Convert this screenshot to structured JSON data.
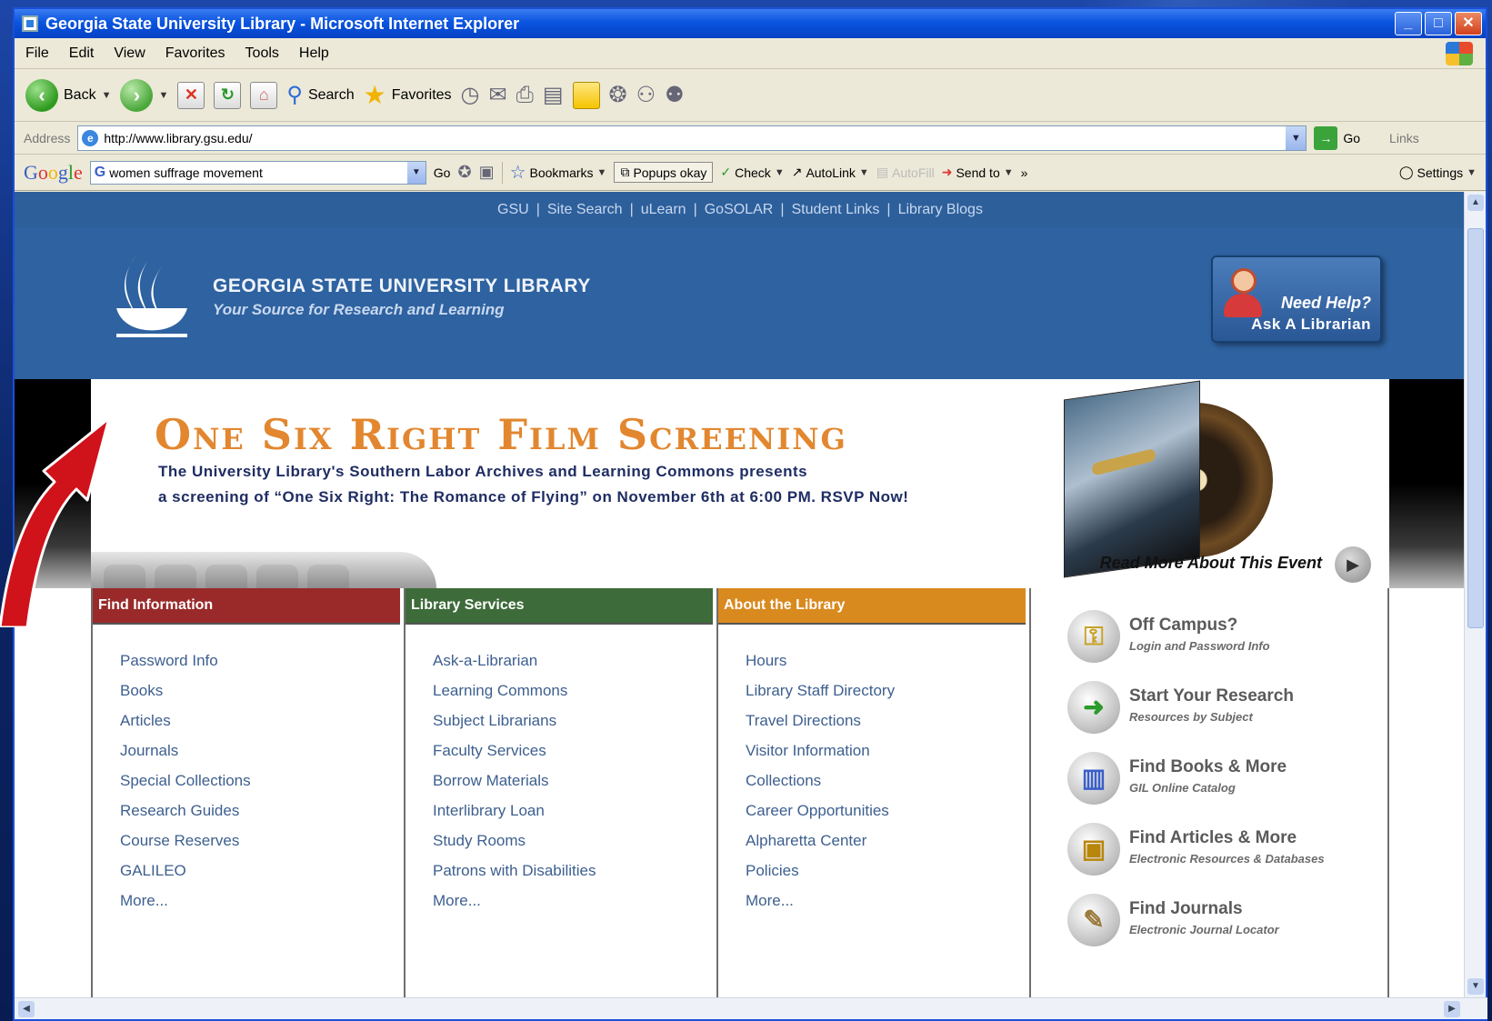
{
  "window": {
    "title": "Georgia State University Library - Microsoft Internet Explorer",
    "buttons": {
      "minimize": "_",
      "maximize": "□",
      "close": "✕"
    }
  },
  "menu": [
    "File",
    "Edit",
    "View",
    "Favorites",
    "Tools",
    "Help"
  ],
  "toolbar": {
    "back": "Back",
    "search": "Search",
    "favorites": "Favorites"
  },
  "address": {
    "label": "Address",
    "url": "http://www.library.gsu.edu/",
    "go": "Go",
    "links": "Links"
  },
  "google_bar": {
    "logo": "Google",
    "query": "women suffrage movement",
    "go": "Go",
    "bookmarks": "Bookmarks",
    "popups": "Popups okay",
    "check": "Check",
    "autolink": "AutoLink",
    "autofill": "AutoFill",
    "send_to": "Send to",
    "more": "»",
    "settings": "Settings"
  },
  "site": {
    "top_links": [
      "GSU",
      "Site Search",
      "uLearn",
      "GoSOLAR",
      "Student Links",
      "Library Blogs"
    ],
    "title": "GEORGIA STATE UNIVERSITY LIBRARY",
    "tagline": "Your Source for Research and Learning",
    "help": {
      "line1": "Need Help?",
      "line2": "Ask A Librarian"
    }
  },
  "hero": {
    "title": "One Six Right Film Screening",
    "line1": "The University Library's Southern Labor Archives and Learning Commons presents",
    "line2": "a screening of “One Six Right: The Romance of Flying” on November 6th at 6:00 PM. RSVP Now!",
    "read_more": "Read More About This Event"
  },
  "columns": [
    {
      "heading": "Find Information",
      "links": [
        "Password Info",
        "Books",
        "Articles",
        "Journals",
        "Special Collections",
        "Research Guides",
        "Course Reserves",
        "GALILEO",
        "More..."
      ]
    },
    {
      "heading": "Library Services",
      "links": [
        "Ask-a-Librarian",
        "Learning Commons",
        "Subject Librarians",
        "Faculty Services",
        "Borrow Materials",
        "Interlibrary Loan",
        "Study Rooms",
        "Patrons with Disabilities",
        "More..."
      ]
    },
    {
      "heading": "About the Library",
      "links": [
        "Hours",
        "Library Staff Directory",
        "Travel Directions",
        "Visitor Information",
        "Collections",
        "Career Opportunities",
        "Alpharetta Center",
        "Policies",
        "More..."
      ]
    }
  ],
  "quick_links": [
    {
      "title": "Off Campus?",
      "sub": "Login and Password Info",
      "icon": "key-icon"
    },
    {
      "title": "Start Your Research",
      "sub": "Resources by Subject",
      "icon": "arrow-icon"
    },
    {
      "title": "Find Books & More",
      "sub": "GIL Online Catalog",
      "icon": "books-icon"
    },
    {
      "title": "Find Articles & More",
      "sub": "Electronic Resources & Databases",
      "icon": "computer-icon"
    },
    {
      "title": "Find Journals",
      "sub": "Electronic Journal Locator",
      "icon": "journal-icon"
    }
  ],
  "colors": {
    "title_bar": "#0a54e0",
    "site_blue": "#2e62a0",
    "find_info": "#9a2a2a",
    "library_services": "#3d6b3a",
    "about_library": "#d98a1f",
    "hero_title": "#e2872f",
    "annotation_arrow": "#d0121b"
  }
}
